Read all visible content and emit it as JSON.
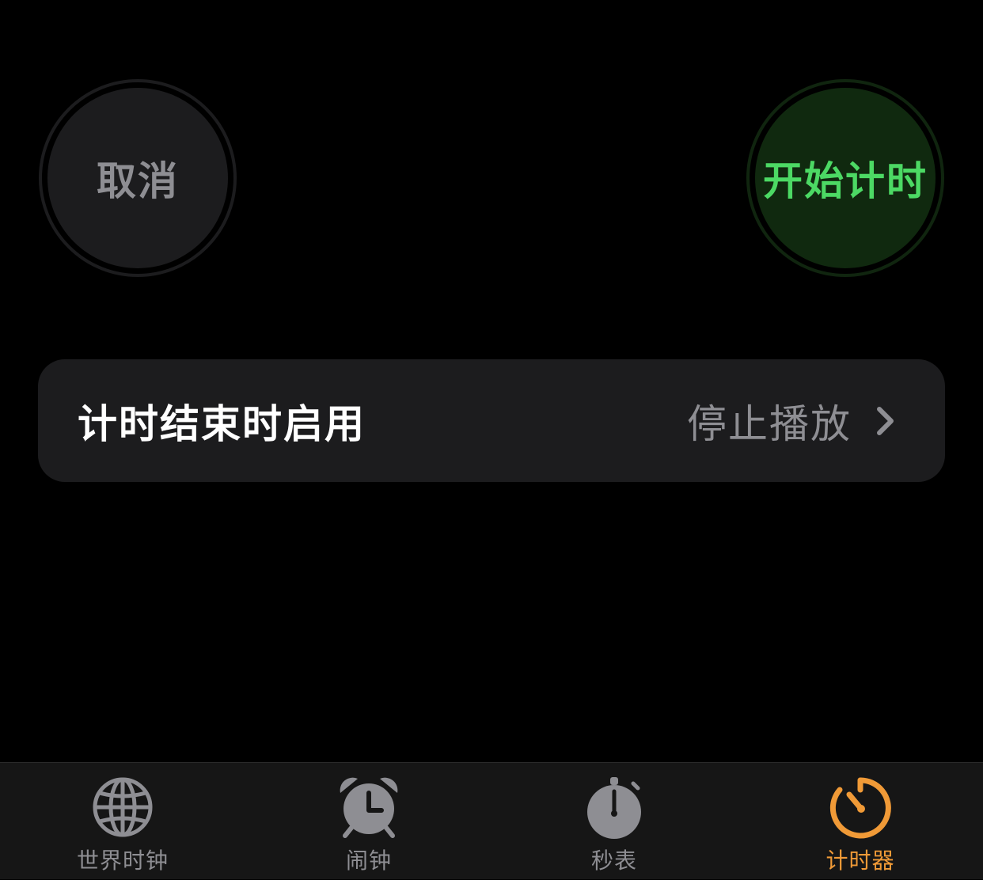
{
  "controls": {
    "cancel_label": "取消",
    "start_label": "开始计时"
  },
  "settings": {
    "when_timer_ends_label": "计时结束时启用",
    "when_timer_ends_value": "停止播放"
  },
  "tabs": [
    {
      "label": "世界时钟",
      "icon": "globe-icon",
      "active": false
    },
    {
      "label": "闹钟",
      "icon": "alarm-clock-icon",
      "active": false
    },
    {
      "label": "秒表",
      "icon": "stopwatch-icon",
      "active": false
    },
    {
      "label": "计时器",
      "icon": "timer-icon",
      "active": true
    }
  ],
  "colors": {
    "background": "#000000",
    "cell_background": "#1c1c1e",
    "start_green": "#4cd964",
    "start_bg": "#10290f",
    "cancel_text": "#8e8e93",
    "active_tab": "#f09a37",
    "inactive_tab": "#8e8e93"
  }
}
